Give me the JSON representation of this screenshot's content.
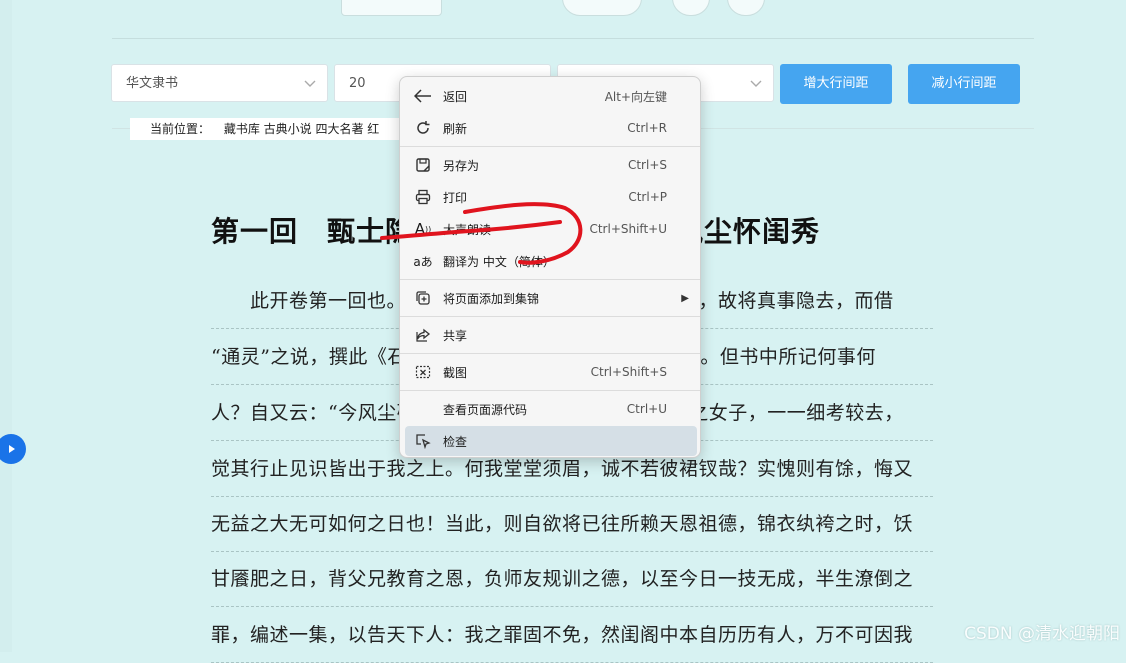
{
  "toolbar": {
    "font_select": "华文隶书",
    "size_select": "20",
    "third_select": "",
    "increase_spacing_label": "增大行间距",
    "decrease_spacing_label": "减小行间距"
  },
  "breadcrumb": {
    "label": "当前位置：",
    "path": "藏书库 古典小说 四大名著 红"
  },
  "chapter": {
    "title": "第一回　甄士隐梦幻识通灵　贾雨村风尘怀闺秀",
    "lines": [
      "　　此开卷第一回也。作者自云：因曾历过一番梦幻之后，故将真事隐去，而借",
      "“通灵”之说，撰此《石头记》一书也。故曰“甄士隐”云云。但书中所记何事何",
      "人？自又云：“今风尘碌碌，一事无成，忽念及当日所有之女子，一一细考较去，",
      "觉其行止见识皆出于我之上。何我堂堂须眉，诚不若彼裙钗哉？实愧则有馀，悔又",
      "无益之大无可如何之日也！当此，则自欲将已往所赖天恩祖德，锦衣纨袴之时，饫",
      "甘餍肥之日，背父兄教育之恩，负师友规训之德，以至今日一技无成，半生潦倒之",
      "罪，编述一集，以告天下人：我之罪固不免，然闺阁中本自历历有人，万不可因我"
    ]
  },
  "context_menu": {
    "items": [
      {
        "label": "返回",
        "shortcut": "Alt+向左键",
        "icon": "back-arrow-icon"
      },
      {
        "label": "刷新",
        "shortcut": "Ctrl+R",
        "icon": "refresh-icon"
      },
      {
        "label": "另存为",
        "shortcut": "Ctrl+S",
        "icon": "save-as-icon"
      },
      {
        "label": "打印",
        "shortcut": "Ctrl+P",
        "icon": "printer-icon"
      },
      {
        "label": "大声朗读",
        "shortcut": "Ctrl+Shift+U",
        "icon": "read-aloud-icon"
      },
      {
        "label": "翻译为 中文（简体）",
        "shortcut": "",
        "icon": "translate-icon"
      },
      {
        "label": "将页面添加到集锦",
        "shortcut": "",
        "icon": "collections-icon"
      },
      {
        "label": "共享",
        "shortcut": "",
        "icon": "share-icon"
      },
      {
        "label": "截图",
        "shortcut": "Ctrl+Shift+S",
        "icon": "screenshot-icon"
      },
      {
        "label": "查看页面源代码",
        "shortcut": "Ctrl+U",
        "icon": ""
      },
      {
        "label": "检查",
        "shortcut": "",
        "icon": "inspect-icon"
      }
    ],
    "read_aloud_icon_glyph": "A",
    "translate_icon_glyph": "aあ"
  },
  "watermark": "CSDN @清水迎朝阳",
  "colors": {
    "background": "#d7f2f2",
    "button_blue": "#45a5f0",
    "highlight_item": "#d5dfe6",
    "scribble_red": "#e0141e"
  }
}
